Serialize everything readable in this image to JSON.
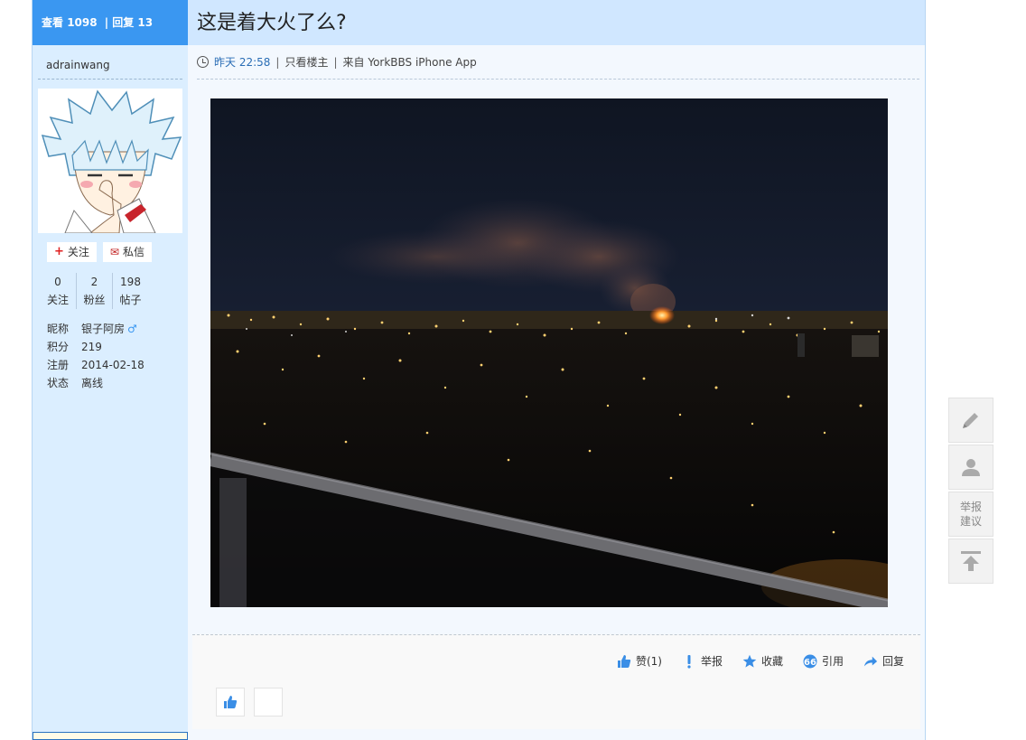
{
  "stats": {
    "views_label": "查看",
    "views": "1098",
    "separator": "|",
    "replies_label": "回复",
    "replies": "13"
  },
  "user": {
    "name": "adrainwang",
    "follow_label": "关注",
    "message_label": "私信",
    "counts": [
      {
        "value": "0",
        "label": "关注"
      },
      {
        "value": "2",
        "label": "粉丝"
      },
      {
        "value": "198",
        "label": "帖子"
      }
    ],
    "info": [
      {
        "key": "昵称",
        "value": "银子阿房"
      },
      {
        "key": "积分",
        "value": "219"
      },
      {
        "key": "注册",
        "value": "2014-02-18"
      },
      {
        "key": "状态",
        "value": "离线"
      }
    ],
    "gender_symbol": "♂"
  },
  "post": {
    "title": "这是着大火了么?",
    "time": "昨天 22:58",
    "sep": "|",
    "only_op": "只看楼主",
    "source": "来自 YorkBBS iPhone App"
  },
  "actions": {
    "like": "赞(1)",
    "report": "举报",
    "favorite": "收藏",
    "quote": "引用",
    "reply": "回复"
  },
  "tools": {
    "report_line1": "举报",
    "report_line2": "建议"
  },
  "colors": {
    "header_blue": "#3a97f1",
    "title_bg": "#d0e7ff",
    "sidebar_bg": "#dbeeff",
    "content_bg": "#f3f8fe",
    "link_blue": "#2a6db5"
  }
}
